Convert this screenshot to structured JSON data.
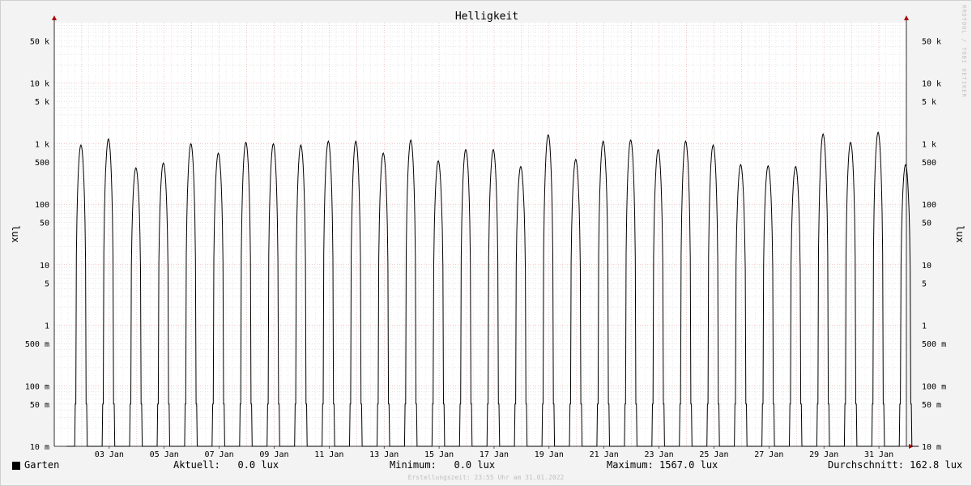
{
  "chart_data": {
    "type": "line",
    "title": "Helligkeit",
    "ylabel": "lux",
    "yscale": "log",
    "ylim": [
      0.01,
      100000
    ],
    "grid": true,
    "x_tick_labels": [
      "03 Jan",
      "05 Jan",
      "07 Jan",
      "09 Jan",
      "11 Jan",
      "13 Jan",
      "15 Jan",
      "17 Jan",
      "19 Jan",
      "21 Jan",
      "23 Jan",
      "25 Jan",
      "27 Jan",
      "29 Jan",
      "31 Jan"
    ],
    "y_tick_labels": [
      {
        "value": 50000,
        "label": "50 k"
      },
      {
        "value": 10000,
        "label": "10 k"
      },
      {
        "value": 5000,
        "label": "5 k"
      },
      {
        "value": 1000,
        "label": "1 k"
      },
      {
        "value": 500,
        "label": "500"
      },
      {
        "value": 100,
        "label": "100"
      },
      {
        "value": 50,
        "label": "50"
      },
      {
        "value": 10,
        "label": "10"
      },
      {
        "value": 5,
        "label": "5"
      },
      {
        "value": 1,
        "label": "1"
      },
      {
        "value": 0.5,
        "label": "500 m"
      },
      {
        "value": 0.1,
        "label": "100 m"
      },
      {
        "value": 0.05,
        "label": "50 m"
      },
      {
        "value": 0.01,
        "label": "10 m"
      }
    ],
    "series": [
      {
        "name": "Garten",
        "color": "#000000",
        "daily_peak_lux": [
          950,
          1200,
          400,
          480,
          1000,
          700,
          1050,
          1000,
          950,
          1100,
          1100,
          700,
          1150,
          520,
          800,
          800,
          420,
          1400,
          550,
          1100,
          1150,
          800,
          1100,
          950,
          450,
          430,
          420,
          1450,
          1050,
          1550,
          450
        ],
        "night_level_lux": 0.05
      }
    ]
  },
  "legend": {
    "series_name": "Garten",
    "aktuell": "Aktuell:   0.0 lux",
    "minimum": "Minimum:   0.0 lux",
    "maximum": "Maximum: 1567.0 lux",
    "durchschnitt": "Durchschnitt: 162.8 lux"
  },
  "footer": "Erstellungszeit: 23:55 Uhr am 31.01.2022",
  "watermark": "RRDTOOL / TOBI OETIKER"
}
